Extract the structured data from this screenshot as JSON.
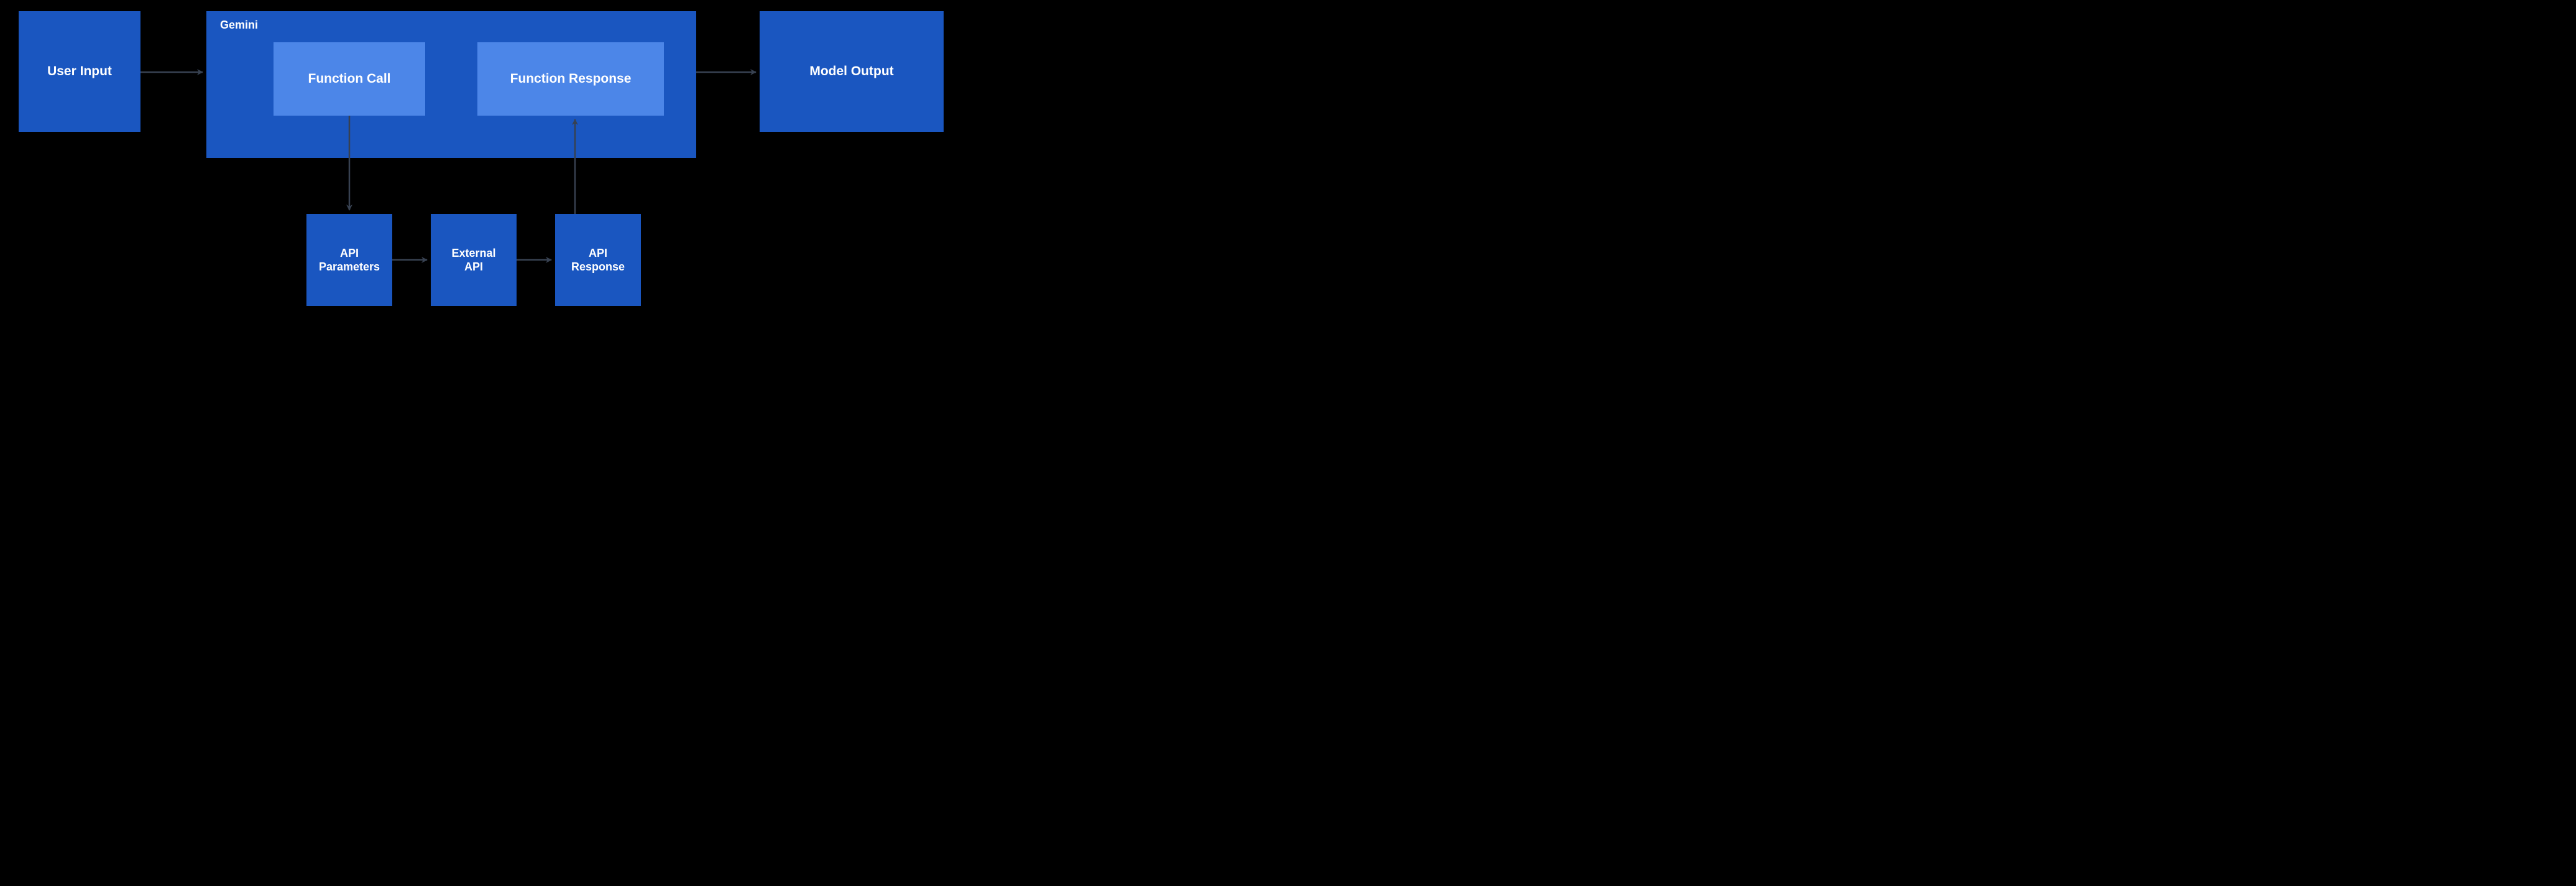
{
  "diagram": {
    "container_label": "Gemini",
    "nodes": {
      "user_input": {
        "label": "User Input"
      },
      "function_call": {
        "label": "Function Call"
      },
      "function_response": {
        "label": "Function Response"
      },
      "model_output": {
        "label": "Model Output"
      },
      "api_parameters": {
        "label": "API\nParameters"
      },
      "external_api": {
        "label": "External\nAPI"
      },
      "api_response": {
        "label": "API\nResponse"
      }
    },
    "edges": [
      [
        "user_input",
        "function_call"
      ],
      [
        "function_call",
        "api_parameters"
      ],
      [
        "api_parameters",
        "external_api"
      ],
      [
        "external_api",
        "api_response"
      ],
      [
        "api_response",
        "function_response"
      ],
      [
        "function_response",
        "model_output"
      ]
    ],
    "colors": {
      "node_dark": "#1a56c0",
      "node_light": "#4c86e8",
      "arrow": "#374151",
      "text": "#ffffff",
      "background": "#000000"
    }
  }
}
